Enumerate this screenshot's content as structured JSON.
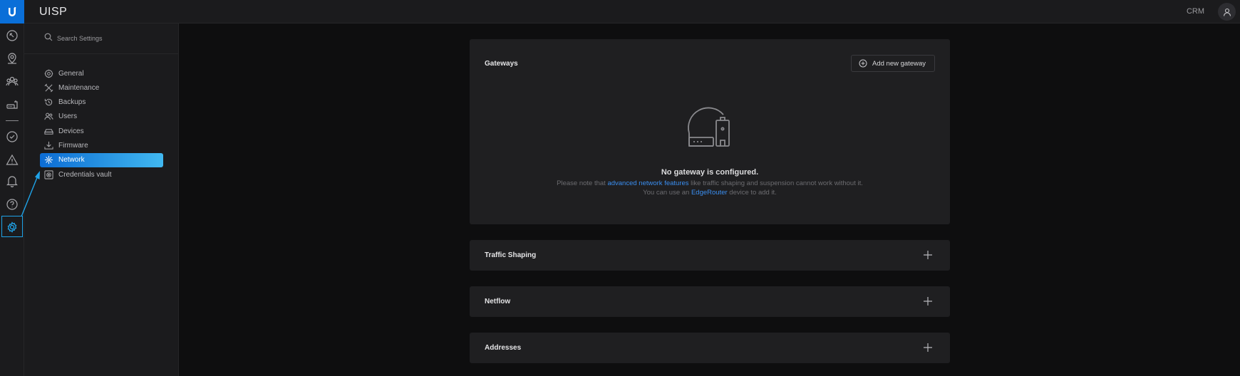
{
  "app": {
    "brand": "UISP",
    "crm_label": "CRM"
  },
  "rail": {
    "icons": [
      "dashboard-icon",
      "site-icon",
      "clients-icon",
      "devices-icon",
      "tasks-icon",
      "alerts-icon",
      "notifications-icon",
      "help-icon",
      "settings-icon"
    ],
    "active": "settings-icon",
    "accent": "#1fa3e8"
  },
  "sidebar": {
    "search": {
      "placeholder": "Search Settings"
    },
    "items": [
      {
        "label": "General",
        "icon": "gear-icon"
      },
      {
        "label": "Maintenance",
        "icon": "tools-icon"
      },
      {
        "label": "Backups",
        "icon": "history-icon"
      },
      {
        "label": "Users",
        "icon": "users-icon"
      },
      {
        "label": "Devices",
        "icon": "device-icon"
      },
      {
        "label": "Firmware",
        "icon": "download-icon"
      },
      {
        "label": "Network",
        "icon": "network-icon",
        "active": true
      },
      {
        "label": "Credentials vault",
        "icon": "vault-icon"
      }
    ]
  },
  "gateways": {
    "title": "Gateways",
    "add_label": "Add new gateway",
    "empty_title": "No gateway is configured.",
    "note_prefix": "Please note that",
    "note_link": "advanced network features",
    "note_suffix": "like traffic shaping and suspension cannot work without it.",
    "hint_prefix": "You can use an",
    "hint_link": "EdgeRouter",
    "hint_suffix": "device to add it."
  },
  "sections": [
    {
      "title": "Traffic Shaping"
    },
    {
      "title": "Netflow"
    },
    {
      "title": "Addresses"
    }
  ],
  "colors": {
    "link": "#3a8ef0",
    "active_gradient_start": "#0c6cd4",
    "active_gradient_end": "#41b8f0"
  }
}
